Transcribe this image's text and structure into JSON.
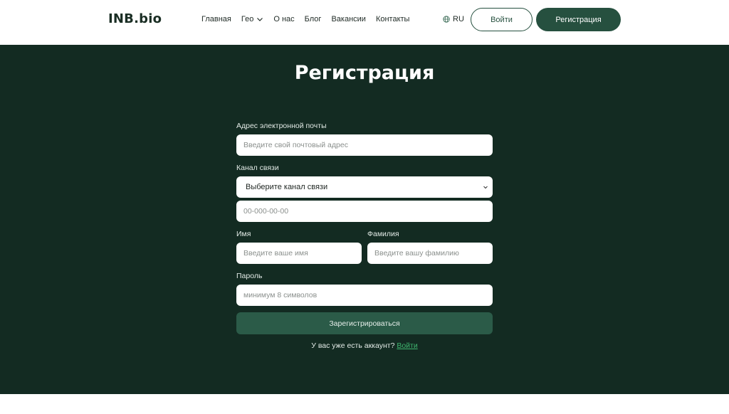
{
  "header": {
    "logo": "INB.bio",
    "nav": [
      "Главная",
      "Гео",
      "О нас",
      "Блог",
      "Вакансии",
      "Контакты"
    ],
    "lang": "RU",
    "login_label": "Войти",
    "register_label": "Регистрация"
  },
  "main": {
    "title": "Регистрация",
    "email_label": "Адрес электронной почты",
    "email_placeholder": "Введите свой почтовый адрес",
    "channel_label": "Канал связи",
    "channel_selected": "Выберите канал связи",
    "phone_placeholder": "00-000-00-00",
    "first_name_label": "Имя",
    "first_name_placeholder": "Введите ваше имя",
    "last_name_label": "Фамилия",
    "last_name_placeholder": "Введите вашу фамилию",
    "password_label": "Пароль",
    "password_placeholder": "минимум 8 символов",
    "submit_label": "Зарегистрироваться",
    "account_question": "У вас уже есть аккаунт?",
    "login_link": "Войти"
  },
  "colors": {
    "background": "#132b22",
    "accent": "#26503f",
    "link": "#3fb56f"
  },
  "icons": [
    "chevron-down-icon",
    "globe-icon"
  ]
}
